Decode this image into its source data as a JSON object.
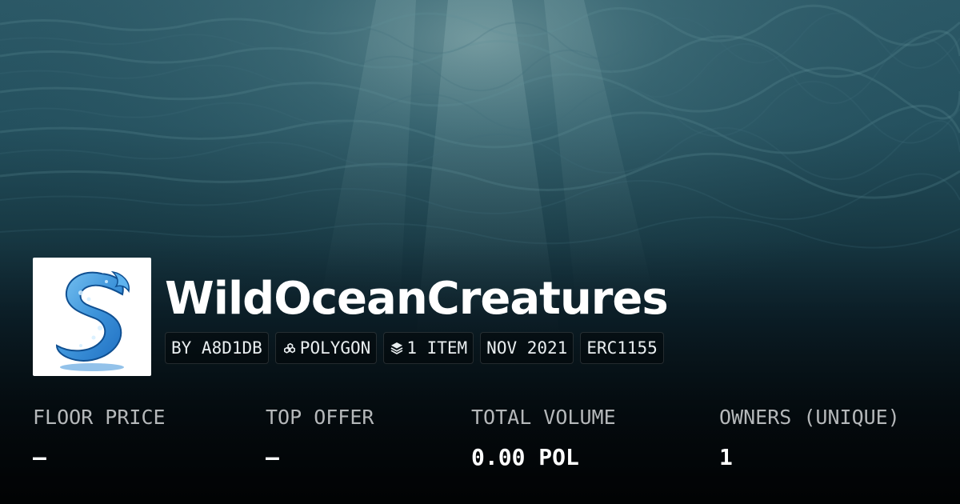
{
  "collection": {
    "name": "WildOceanCreatures",
    "logo_icon": "wave-s-logo-icon"
  },
  "tags": [
    {
      "label": "BY A8D1DB",
      "icon": ""
    },
    {
      "label": "POLYGON",
      "icon": "polygon-chain-icon"
    },
    {
      "label": "1 ITEM",
      "icon": "layers-icon"
    },
    {
      "label": "NOV 2021",
      "icon": ""
    },
    {
      "label": "ERC1155",
      "icon": ""
    }
  ],
  "stats": [
    {
      "label": "FLOOR PRICE",
      "value": "–"
    },
    {
      "label": "TOP OFFER",
      "value": "–"
    },
    {
      "label": "TOTAL VOLUME",
      "value": "0.00 POL"
    },
    {
      "label": "OWNERS (UNIQUE)",
      "value": "1"
    }
  ],
  "colors": {
    "water_top": "#2b5866",
    "water_bottom": "#050d12",
    "text_primary": "#ffffff",
    "text_muted": "#b5b8ba"
  }
}
